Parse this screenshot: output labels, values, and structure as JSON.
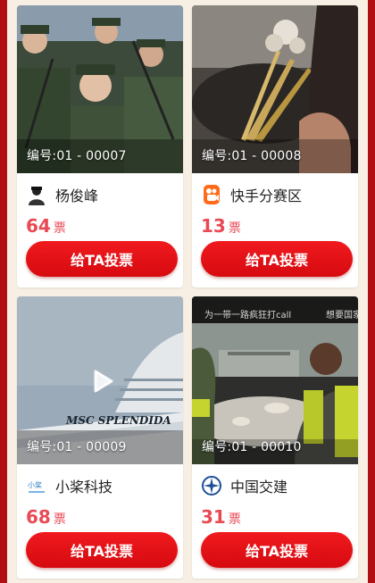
{
  "cards": [
    {
      "code": "编号:01 - 00007",
      "name": "杨俊峰",
      "votes": "64",
      "vote_unit": "票",
      "button_label": "给TA投票",
      "has_play": false
    },
    {
      "code": "编号:01 - 00008",
      "name": "快手分赛区",
      "votes": "13",
      "vote_unit": "票",
      "button_label": "给TA投票",
      "has_play": false
    },
    {
      "code": "编号:01 - 00009",
      "name": "小桨科技",
      "votes": "68",
      "vote_unit": "票",
      "button_label": "给TA投票",
      "has_play": true,
      "image_text": "MSC SPLENDIDA"
    },
    {
      "code": "编号:01 - 00010",
      "name": "中国交建",
      "votes": "31",
      "vote_unit": "票",
      "button_label": "给TA投票",
      "has_play": false,
      "image_caption": "为一带一路疯狂打call",
      "image_caption_right": "想要国家"
    }
  ],
  "colors": {
    "frame": "#b00e12",
    "panel": "#f7efe3",
    "accent_red": "#e84a54",
    "button_red": "#e60f14"
  },
  "icons": [
    "person-avatar-icon",
    "kuaishou-logo-icon",
    "xiaojiang-logo-icon",
    "cccc-logo-icon",
    "play-icon"
  ]
}
